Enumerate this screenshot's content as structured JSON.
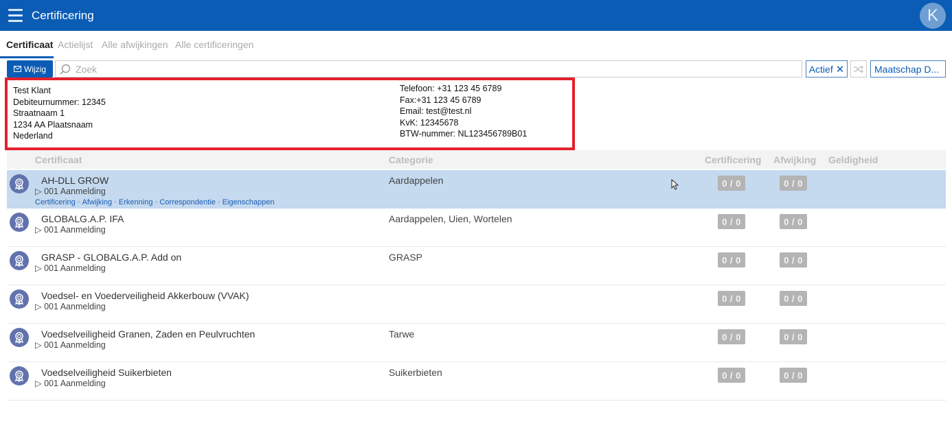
{
  "header": {
    "title": "Certificering",
    "avatar_letter": "K",
    "bar_color": "#0a5cb5"
  },
  "tabs": [
    {
      "label": "Certificaat",
      "active": true
    },
    {
      "label": "Actielijst",
      "active": false
    },
    {
      "label": "Alle afwijkingen",
      "active": false
    },
    {
      "label": "Alle certificeringen",
      "active": false
    }
  ],
  "toolbar": {
    "edit_label": "Wijzig",
    "search_placeholder": "Zoek",
    "search_value": "",
    "active_filter_label": "Actief",
    "active_filter_remove": "✕",
    "company_filter_label": "Maatschap D..."
  },
  "client": {
    "name": "Test Klant",
    "debtor": "Debiteurnummer: 12345",
    "street": "Straatnaam 1",
    "city": "1234 AA Plaatsnaam",
    "country": "Nederland",
    "phone": "Telefoon: +31 123 45 6789",
    "fax": "Fax:+31 123 45 6789",
    "email": "Email: test@test.nl",
    "kvk": "KvK: 12345678",
    "vat": "BTW-nummer: NL123456789B01"
  },
  "table": {
    "columns": {
      "certificate": "Certificaat",
      "category": "Categorie",
      "certification": "Certificering",
      "deviation": "Afwijking",
      "validity": "Geldigheid"
    },
    "rows": [
      {
        "title": "AH-DLL GROW",
        "sub": "▷ 001 Aanmelding",
        "category": "Aardappelen",
        "cert": "0 / 0",
        "afw": "0 / 0",
        "selected": true
      },
      {
        "title": "GLOBALG.A.P. IFA",
        "sub": "▷ 001 Aanmelding",
        "category": "Aardappelen, Uien, Wortelen",
        "cert": "0 / 0",
        "afw": "0 / 0"
      },
      {
        "title": "GRASP - GLOBALG.A.P. Add on",
        "sub": "▷ 001 Aanmelding",
        "category": "GRASP",
        "cert": "0 / 0",
        "afw": "0 / 0"
      },
      {
        "title": "Voedsel- en Voederveiligheid Akkerbouw (VVAK)",
        "sub": "▷ 001 Aanmelding",
        "category": "",
        "cert": "0 / 0",
        "afw": "0 / 0"
      },
      {
        "title": "Voedselveiligheid Granen, Zaden en Peulvruchten",
        "sub": "▷ 001 Aanmelding",
        "category": "Tarwe",
        "cert": "0 / 0",
        "afw": "0 / 0"
      },
      {
        "title": "Voedselveiligheid Suikerbieten",
        "sub": "▷ 001 Aanmelding",
        "category": "Suikerbieten",
        "cert": "0 / 0",
        "afw": "0 / 0"
      }
    ],
    "row_links": [
      "Certificering",
      "Afwijking",
      "Erkenning",
      "Correspondentie",
      "Eigenschappen"
    ],
    "link_separator": "◦"
  },
  "colors": {
    "highlight_box": "#e4202c",
    "selected_row": "#c5d9ef",
    "icon_bg": "#6272ad"
  },
  "icons": [
    "hamburger-menu-icon",
    "envelope-icon",
    "search-icon",
    "shuffle-icon",
    "award-ribbon-icon",
    "mouse-cursor-icon"
  ]
}
